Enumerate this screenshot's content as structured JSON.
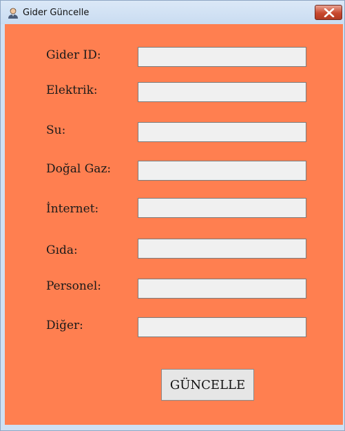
{
  "window": {
    "title": "Gider Güncelle",
    "app_icon": "user-icon",
    "close_icon": "close-icon"
  },
  "colors": {
    "form_background": "#ff7f50",
    "input_background": "#f0f0f0",
    "close_button": "#c8492f"
  },
  "form": {
    "fields": [
      {
        "label": "Gider ID:",
        "value": ""
      },
      {
        "label": "Elektrik:",
        "value": ""
      },
      {
        "label": "Su:",
        "value": ""
      },
      {
        "label": "Doğal Gaz:",
        "value": ""
      },
      {
        "label": "İnternet:",
        "value": ""
      },
      {
        "label": "Gıda:",
        "value": ""
      },
      {
        "label": "Personel:",
        "value": ""
      },
      {
        "label": "Diğer:",
        "value": ""
      }
    ],
    "submit_label": "GÜNCELLE"
  }
}
